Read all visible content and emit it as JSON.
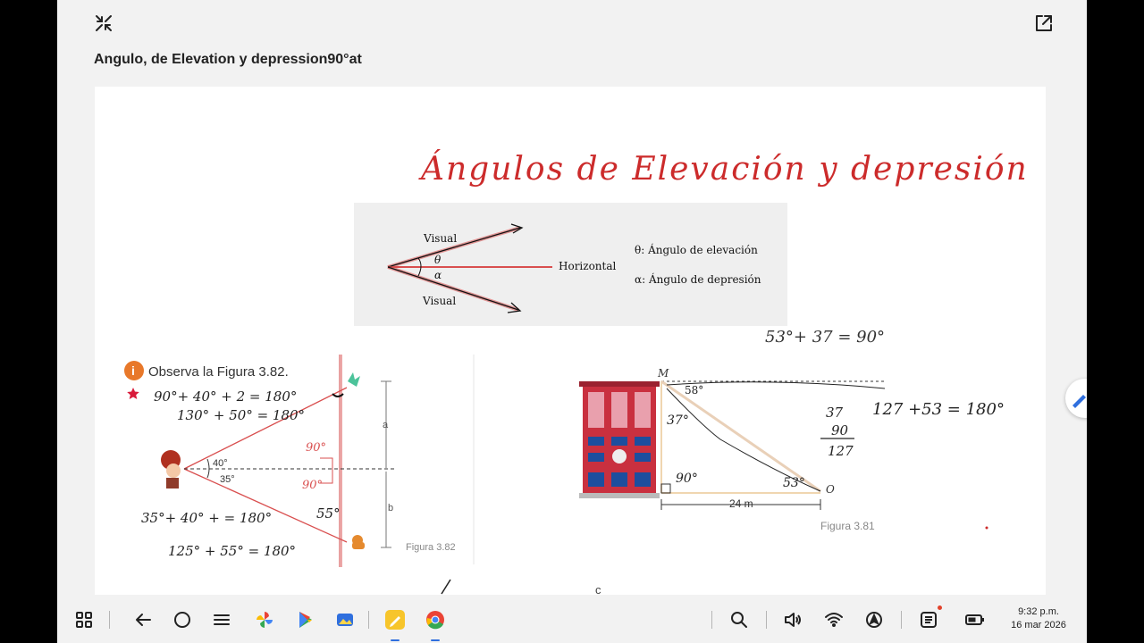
{
  "app": {
    "title": "Angulo, de Elevation y depression90°at",
    "icons": {
      "collapse": "collapse-icon",
      "open_external": "open-external-icon",
      "pen_tool": "pen-icon"
    }
  },
  "note": {
    "heading": "Ángulos de Elevación y depresión",
    "diagram_top": {
      "visual_up": "Visual",
      "visual_down": "Visual",
      "theta": "θ",
      "alpha": "α",
      "horizontal": "Horizontal",
      "legend_elevation": "θ: Ángulo de elevación",
      "legend_depression": "α: Ángulo de depresión"
    },
    "figure_382": {
      "info_badge": "i",
      "prompt": "Observa la Figura 3.82.",
      "angle_top": "40°",
      "angle_bottom": "35°",
      "label_a": "a",
      "label_b": "b",
      "caption": "Figura 3.82",
      "hw_line1": "90°+ 40° + 2 = 180°",
      "hw_line2": "130° + 50° = 180°",
      "hw_line3": "35°+ 40° +      = 180°",
      "hw_line4": "125° + 55° = 180°",
      "hw_90": "90°",
      "hw_90b": "90°",
      "hw_55": "55°"
    },
    "figure_381": {
      "point_m": "M",
      "point_o": "O",
      "angle_58": "58°",
      "angle_37": "37°",
      "angle_90": "90°",
      "angle_53": "53°",
      "distance": "24 m",
      "caption": "Figura 3.81",
      "hw_sum_top": "53°+ 37 = 90°",
      "hw_col1": "37",
      "hw_col2": "90",
      "hw_col3": "127",
      "hw_sum_right": "127 +53 = 180°"
    },
    "partial_bottom": "c"
  },
  "taskbar": {
    "icons": [
      "apps-grid-icon",
      "back-icon",
      "home-icon",
      "recents-icon",
      "photos-icon",
      "play-store-icon",
      "gallery-icon",
      "notes-icon",
      "chrome-icon",
      "search-icon",
      "volume-icon",
      "wifi-icon",
      "location-icon",
      "notification-list-icon",
      "battery-icon"
    ],
    "time": "9:32 p.m.",
    "date": "16 mar 2026"
  },
  "colors": {
    "ink_red": "#cc2b2b",
    "diagram_red": "#d94f4f",
    "accent_blue": "#2f6fde",
    "info_orange": "#e8782a",
    "building_red": "#c9303f"
  }
}
